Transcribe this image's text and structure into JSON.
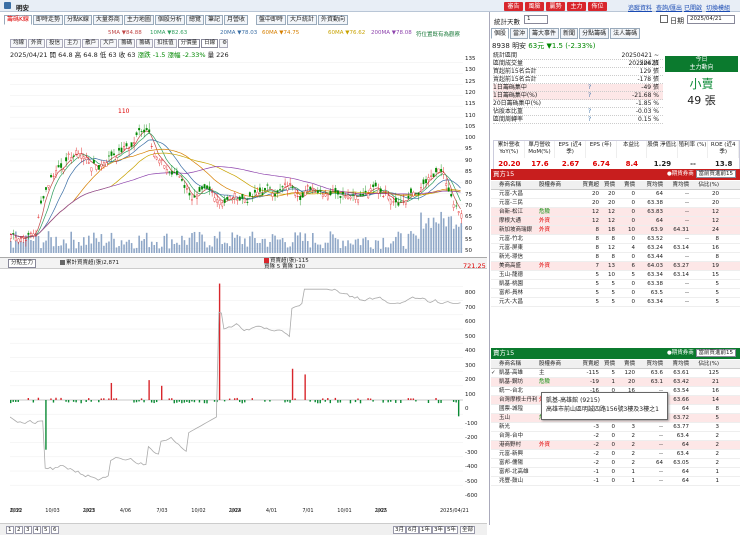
{
  "app": {
    "title": "明安",
    "top_buttons": [
      "審告",
      "風險",
      "贏勢",
      "主力",
      "佈位"
    ],
    "top_links": [
      "追蹤資料",
      "查詢/匯出",
      "已開啟",
      "切換模組"
    ]
  },
  "left_tabs": [
    "籌碼K線",
    "即時走勢",
    "分點K線",
    "大量券商",
    "主力地圖",
    "個股分析",
    "總覽",
    "筆記",
    "月營收"
  ],
  "left_tabs_right": [
    "盤中即時",
    "大戶統計",
    "外資動向"
  ],
  "ma_legend": [
    {
      "label": "5MA ▼84.88",
      "color": "#c04848"
    },
    {
      "label": "10MA ▼82.63",
      "color": "#2e9e5e"
    },
    {
      "label": "20MA ▼78.03",
      "color": "#3a6ea5"
    },
    {
      "label": "60MA ▼74.75",
      "color": "#d67f00"
    },
    {
      "label": "60MA ▼76.62",
      "color": "#c8a200"
    },
    {
      "label": "200MA ▼78.08",
      "color": "#8e44ad"
    },
    {
      "label": "符位置既有為觀察",
      "color": "#1a7a3a"
    }
  ],
  "toolbar": {
    "items": [
      "均線",
      "外資",
      "投信",
      "主力",
      "散戶",
      "大戶",
      "籌碼",
      "籌碼",
      "扣抵值"
    ],
    "sel1": "分價量",
    "sel2": "日線"
  },
  "pricebar": {
    "date": "2025/04/21",
    "open": "開 64.8",
    "high": "高 64.8",
    "low": "低 63",
    "close": "收 63",
    "change": "漲跌 -1.5",
    "pct": "漲幅 -2.33%",
    "vol": "量 226"
  },
  "main_chart": {
    "y_labels": [
      "135",
      "130",
      "125",
      "120",
      "115",
      "110",
      "105",
      "100",
      "95",
      "90",
      "85",
      "80",
      "75",
      "70",
      "65",
      "60",
      "55",
      "50"
    ],
    "peak_label": "110",
    "low_label": "50"
  },
  "sub_chart": {
    "legend_sel": "分點主力",
    "legend_item1": "累計買賣超(張)2,871",
    "legend_item2a": "買賣超(張)-115",
    "legend_item2b": "買隊 5 賣隊 120",
    "top_value": "721.25",
    "y_labels": [
      "800",
      "700",
      "600",
      "500",
      "400",
      "300",
      "200",
      "100",
      "0",
      "-100",
      "-200",
      "-300",
      "-400",
      "-500",
      "-600"
    ]
  },
  "x_axis": [
    {
      "t": "6/30",
      "y": "2022"
    },
    {
      "t": "10/03",
      "y": ""
    },
    {
      "t": "1/03",
      "y": "2023"
    },
    {
      "t": "4/06",
      "y": ""
    },
    {
      "t": "7/03",
      "y": ""
    },
    {
      "t": "10/02",
      "y": ""
    },
    {
      "t": "1/02",
      "y": "2024"
    },
    {
      "t": "4/01",
      "y": ""
    },
    {
      "t": "7/01",
      "y": ""
    },
    {
      "t": "10/01",
      "y": ""
    },
    {
      "t": "1/02",
      "y": "2025"
    },
    {
      "t": "2025/04/21",
      "y": ""
    }
  ],
  "pager": {
    "pages": [
      "1",
      "2",
      "3",
      "4",
      "5",
      "6"
    ],
    "ranges": [
      "3月",
      "6月",
      "1年",
      "3年",
      "5年"
    ],
    "all": "全部"
  },
  "right": {
    "stat_days_label": "統計天數",
    "stat_days": "1",
    "date_label": "日期",
    "date": "2025/04/21",
    "tabs": [
      "個股",
      "當沖",
      "籌大事件",
      "新聞",
      "分點籌碼",
      "法人籌碼"
    ],
    "stock_id": "8938",
    "stock_name": "明安",
    "stock_price": "63元",
    "stock_change": "▼1.5 (-2.33%)",
    "stats": [
      {
        "k": "統計區間",
        "v": "20250421 ~ 20250421",
        "q": ""
      },
      {
        "k": "區間成交量",
        "v": "226 張",
        "q": ""
      },
      {
        "k": "買超前15名合計",
        "v": "129 張",
        "q": ""
      },
      {
        "k": "賣超前15名合計",
        "v": "-178 張",
        "q": ""
      },
      {
        "k": "1日籌碼集中",
        "v": "-49 張",
        "q": "?"
      },
      {
        "k": "1日籌碼集中(%)",
        "v": "-21.68 %",
        "q": "?"
      },
      {
        "k": "20日籌碼集中(%)",
        "v": "-1.85 %",
        "q": ""
      },
      {
        "k": "佔股本比重",
        "v": "-0.03 %",
        "q": "?"
      },
      {
        "k": "區間周轉率",
        "v": "0.15 %",
        "q": "?"
      }
    ],
    "day_box": {
      "title": "今日",
      "sub": "主力動向",
      "big": "小賣",
      "vol": "49 張"
    },
    "fin_heads": [
      "累計營收 YoY(%)",
      "單月營收 MoM(%)",
      "EPS (近4季)",
      "EPS (年)",
      "本益比",
      "股價 淨值比",
      "殖利率 (%)",
      "ROE (近4季)"
    ],
    "fin_vals": [
      "20.20",
      "17.6",
      "2.67",
      "6.74",
      "8.4",
      "1.29",
      "--",
      "13.8"
    ],
    "buy_title": "買方15",
    "sell_title": "賣方15",
    "unit_label": "單位:",
    "unit_sel1": "張",
    "unit_sel2": "主力",
    "group_label": "●期貨券商",
    "group_sel": "當前買進前15",
    "col_heads": [
      "",
      "券商名稱",
      "股權券商",
      "買賣超",
      "買價",
      "賣價",
      "買均價",
      "賣均價",
      "佔比(%)"
    ],
    "buy_rows": [
      [
        "",
        "元富-大昌",
        "",
        "20",
        "20",
        "0",
        "64",
        "--",
        "20"
      ],
      [
        "",
        "元富-三民",
        "",
        "20",
        "20",
        "0",
        "63.38",
        "--",
        "20"
      ],
      [
        "",
        "台新-松江",
        "危險",
        "12",
        "12",
        "0",
        "63.83",
        "--",
        "12"
      ],
      [
        "",
        "摩根大通",
        "外資",
        "12",
        "12",
        "0",
        "64",
        "--",
        "12"
      ],
      [
        "",
        "新加坡商瑞銀",
        "外資",
        "8",
        "18",
        "10",
        "63.9",
        "64.31",
        "24"
      ],
      [
        "",
        "元富-竹北",
        "",
        "8",
        "8",
        "0",
        "63.52",
        "--",
        "8"
      ],
      [
        "",
        "元富-屏東",
        "",
        "8",
        "12",
        "4",
        "63.24",
        "63.14",
        "16"
      ],
      [
        "",
        "新光-璟信",
        "",
        "8",
        "8",
        "0",
        "63.44",
        "--",
        "8"
      ],
      [
        "",
        "美商高盛",
        "外資",
        "7",
        "13",
        "6",
        "64.03",
        "63.27",
        "19"
      ],
      [
        "",
        "玉山-龍德",
        "",
        "5",
        "10",
        "5",
        "63.34",
        "63.14",
        "15"
      ],
      [
        "",
        "凱基-桃園",
        "",
        "5",
        "5",
        "0",
        "63.38",
        "--",
        "5"
      ],
      [
        "",
        "富邦-員林",
        "",
        "5",
        "5",
        "0",
        "63.5",
        "--",
        "5"
      ],
      [
        "",
        "元大-大昌",
        "",
        "5",
        "5",
        "0",
        "63.34",
        "--",
        "5"
      ]
    ],
    "sell_rows": [
      [
        "✓",
        "凱基-高雄",
        "主",
        "-115",
        "5",
        "120",
        "63.6",
        "63.61",
        "125"
      ],
      [
        "",
        "凱基-鋼坊",
        "危險",
        "-19",
        "1",
        "20",
        "63.1",
        "63.42",
        "21"
      ],
      [
        "",
        "統一-台北",
        "",
        "-16",
        "0",
        "16",
        "--",
        "63.54",
        "16"
      ],
      [
        "",
        "台灣摩根士丹利",
        "外資",
        "-14",
        "0",
        "14",
        "--",
        "63.66",
        "14"
      ],
      [
        "",
        "國票-城隍",
        "",
        "-6",
        "1",
        "7",
        "63.1",
        "64",
        "8"
      ],
      [
        "",
        "玉山",
        "危險",
        "-5",
        "0",
        "5",
        "--",
        "63.72",
        "5"
      ],
      [
        "",
        "新光",
        "",
        "-3",
        "0",
        "3",
        "--",
        "63.77",
        "3"
      ],
      [
        "",
        "台灣-台中",
        "",
        "-2",
        "0",
        "2",
        "--",
        "63.4",
        "2"
      ],
      [
        "",
        "港商野村",
        "外資",
        "-2",
        "0",
        "2",
        "--",
        "64",
        "2"
      ],
      [
        "",
        "元富-新興",
        "",
        "-2",
        "0",
        "2",
        "--",
        "63.4",
        "2"
      ],
      [
        "",
        "富邦-儒陽",
        "",
        "-2",
        "0",
        "2",
        "64",
        "63.05",
        "2"
      ],
      [
        "",
        "富邦-北高雄",
        "",
        "-1",
        "0",
        "1",
        "--",
        "64",
        "1"
      ],
      [
        "",
        "兆豐-鼓山",
        "",
        "-1",
        "0",
        "1",
        "--",
        "64",
        "1"
      ]
    ],
    "tooltip": {
      "name": "凱基-高雄館 (9215)",
      "addr": "高雄市前山區明誠四路156號3樓及3樓之1"
    }
  },
  "colors": {
    "red": "#d00000",
    "green": "#0a8a34",
    "buy_bar": "#d8262c",
    "sell_bar": "#0a8a34"
  }
}
